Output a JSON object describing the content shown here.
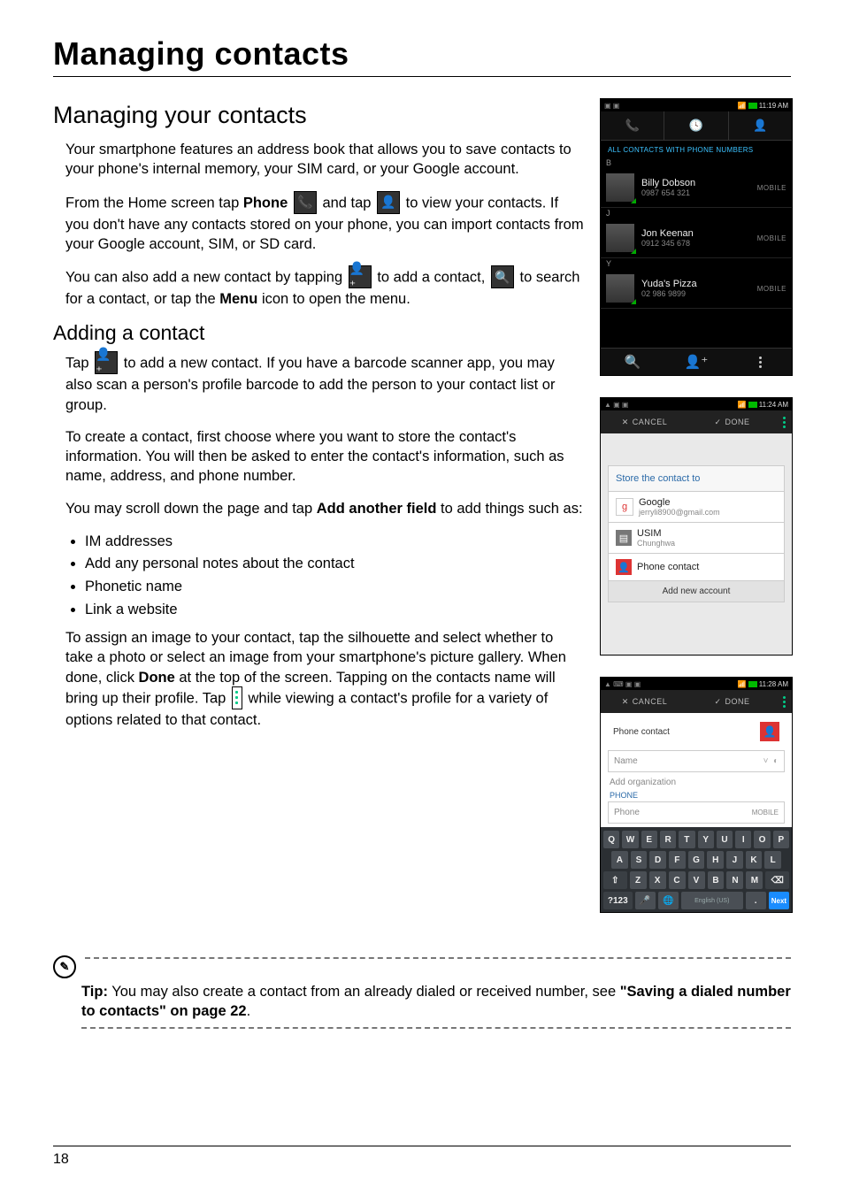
{
  "doc": {
    "title": "Managing contacts",
    "section1_heading": "Managing your contacts",
    "p1": "Your smartphone features an address book that allows you to save contacts to your phone's internal memory, your SIM card, or your Google account.",
    "p2a": "From the Home screen tap ",
    "p2b": "Phone",
    "p2c": " and tap ",
    "p2d": " to view your contacts. If you don't have any contacts stored on your phone, you can import contacts from your Google account, SIM, or SD card.",
    "p3a": "You can also add a new contact by tapping ",
    "p3b": " to add a contact, ",
    "p3c": " to search for a contact, or tap the ",
    "p3d": "Menu",
    "p3e": " icon to open the menu.",
    "section2_heading": "Adding a contact",
    "p4a": "Tap ",
    "p4b": " to add a new contact. If you have a barcode scanner app, you may also scan a person's profile barcode to add the person to your contact list or group.",
    "p5": "To create a contact, first choose where you want to store the contact's information. You will then be asked to enter the contact's information, such as name, address, and phone number.",
    "p6a": "You may scroll down the page and tap ",
    "p6b": "Add another field",
    "p6c": " to add things such as:",
    "list": {
      "i1": "IM addresses",
      "i2": "Add any personal notes about the contact",
      "i3": "Phonetic name",
      "i4": "Link a website"
    },
    "p7a": "To assign an image to your contact, tap the silhouette and select whether to take a photo or select an image from your smartphone's picture gallery. When done, click ",
    "p7b": "Done",
    "p7c": " at the top of the screen. Tapping on the contacts name will bring up their profile. Tap ",
    "p7d": " while viewing a contact's profile for a variety of options related to that contact.",
    "tip_label": "Tip:",
    "tip_body": " You may also create a contact from an already dialed or received number, see ",
    "tip_link": "\"Saving a dialed number to contacts\" on page 22",
    "tip_period": ".",
    "page_number": "18"
  },
  "shot1": {
    "time": "11:19 AM",
    "header": "ALL CONTACTS WITH PHONE NUMBERS",
    "letterB": "B",
    "letterJ": "J",
    "letterY": "Y",
    "c1_name": "Billy Dobson",
    "c1_num": "0987 654 321",
    "c2_name": "Jon Keenan",
    "c2_num": "0912 345 678",
    "c3_name": "Yuda's Pizza",
    "c3_num": "02 986 9899",
    "type": "MOBILE"
  },
  "shot2": {
    "time": "11:24 AM",
    "cancel": "CANCEL",
    "done": "DONE",
    "store_label": "Store the contact to",
    "google": "Google",
    "google_sub": "jerryli8900@gmail.com",
    "usim": "USIM",
    "usim_sub": "Chunghwa",
    "phone_contact": "Phone contact",
    "add_acc": "Add new account"
  },
  "shot3": {
    "time": "11:28 AM",
    "cancel": "CANCEL",
    "done": "DONE",
    "phone_contact": "Phone contact",
    "name": "Name",
    "add_org": "Add organization",
    "phone_label": "PHONE",
    "phone_ph": "Phone",
    "phone_type": "MOBILE",
    "kbd_r1": [
      "Q",
      "W",
      "E",
      "R",
      "T",
      "Y",
      "U",
      "I",
      "O",
      "P"
    ],
    "kbd_r2": [
      "A",
      "S",
      "D",
      "F",
      "G",
      "H",
      "J",
      "K",
      "L"
    ],
    "kbd_r3_shift": "⇧",
    "kbd_r3": [
      "Z",
      "X",
      "C",
      "V",
      "B",
      "N",
      "M"
    ],
    "kbd_r3_del": "⌫",
    "kbd_r4_sym": "?123",
    "kbd_r4_mic": "🎤",
    "kbd_r4_globe": "🌐",
    "kbd_r4_space": "English (US)",
    "kbd_r4_dot": ".",
    "kbd_r4_next": "Next"
  }
}
